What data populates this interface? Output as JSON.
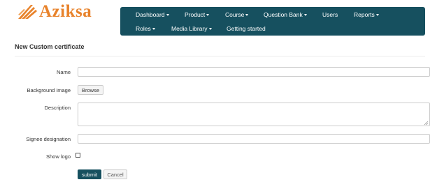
{
  "brand": {
    "name": "Aziksa",
    "color": "#e8822a"
  },
  "nav": {
    "background": "#16505f",
    "items": [
      {
        "label": "Dashboard",
        "dropdown": true
      },
      {
        "label": "Product",
        "dropdown": true
      },
      {
        "label": "Course",
        "dropdown": true
      },
      {
        "label": "Question Bank",
        "dropdown": true
      },
      {
        "label": "Users",
        "dropdown": false
      },
      {
        "label": "Reports",
        "dropdown": true
      },
      {
        "label": "Roles",
        "dropdown": true
      },
      {
        "label": "Media Library",
        "dropdown": true
      },
      {
        "label": "Getting started",
        "dropdown": false
      }
    ]
  },
  "page": {
    "title": "New Custom certificate"
  },
  "form": {
    "name_label": "Name",
    "name_value": "",
    "background_label": "Background image",
    "browse_label": "Browse",
    "description_label": "Description",
    "description_value": "",
    "signee_label": "Signee designation",
    "signee_value": "",
    "show_logo_label": "Show logo",
    "show_logo_checked": false,
    "submit_label": "submit",
    "cancel_label": "Cancel"
  }
}
